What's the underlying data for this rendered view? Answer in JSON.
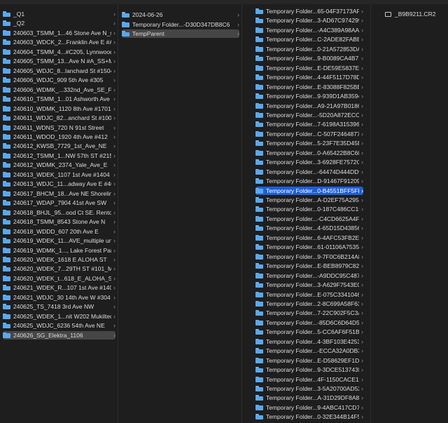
{
  "column1": {
    "items": [
      {
        "label": "_Q1"
      },
      {
        "label": "_Q2"
      },
      {
        "label": "240603_TSMM_1...46 Stone Ave N_ss"
      },
      {
        "label": "240603_WDCK_2...Franklin Ave E #A"
      },
      {
        "label": "240604_TSMM_4...#C205, Lynnwood"
      },
      {
        "label": "240605_TSMM_13...Ave N #A_SS+MP"
      },
      {
        "label": "240605_WDJC_8...lanchard St #1504"
      },
      {
        "label": "240606_WDJC_909 5th Ave #305"
      },
      {
        "label": "240606_WDMK_...332nd_Ave_SE_FC"
      },
      {
        "label": "240610_TSMM_1...01 Ashworth Ave N"
      },
      {
        "label": "240610_WDMK_1120 8th Ave #1701"
      },
      {
        "label": "240611_WDJC_82...anchard St #1003"
      },
      {
        "label": "240611_WDNS_720 N 91st Street"
      },
      {
        "label": "240611_WDOD_1920 4th Ave #412"
      },
      {
        "label": "240612_KWSB_7729_1st_Ave_NE"
      },
      {
        "label": "240612_TSMM_1...NW 57th ST #215"
      },
      {
        "label": "240612_WDMK_2374_Yale_Ave_E"
      },
      {
        "label": "240613_WDEK_1107 1st Ave #1404"
      },
      {
        "label": "240613_WDJC_11...adway Ave E #401"
      },
      {
        "label": "240617_BHCM_18...Ave NE Shoreline"
      },
      {
        "label": "240617_WDAP_7904 41st Ave SW"
      },
      {
        "label": "240618_BHJL_95...ood Ct SE. Renton"
      },
      {
        "label": "240618_TSMM_8543 Stone Ave N"
      },
      {
        "label": "240618_WDDD_607 20th Ave E"
      },
      {
        "label": "240619_WDEK_11...AVE_multiple units"
      },
      {
        "label": "240619_WDMK_1..., Lake Forest Park"
      },
      {
        "label": "240620_WDEK_1618 E ALOHA ST"
      },
      {
        "label": "240620_WDEK_7...29TH ST #101_MI"
      },
      {
        "label": "240620_WDEK_t...618_E_ALOHA_ST"
      },
      {
        "label": "240621_WDEK_R...107 1st Ave #1404"
      },
      {
        "label": "240621_WDJC_30 14th Ave W #304"
      },
      {
        "label": "240625_TS_7418 3rd Ave NW"
      },
      {
        "label": "240625_WDEK_1...nit W202 Mukilteo"
      },
      {
        "label": "240625_WDJC_6236 54th Ave NE"
      },
      {
        "label": "240626_SG_Elektra_1106"
      }
    ]
  },
  "column2": {
    "items": [
      {
        "label": "2024-06-26"
      },
      {
        "label": "Temporary Folder...-D30D347DB8C6"
      },
      {
        "label": "TempParent"
      }
    ]
  },
  "column3": {
    "items": [
      {
        "label": "Temporary Folder...65-04F37173AF1D"
      },
      {
        "label": "Temporary Folder...3-AD67C9742992"
      },
      {
        "label": "Temporary Folder...-A4C389A98AA2"
      },
      {
        "label": "Temporary Folder...C-2ADE82FABB7C"
      },
      {
        "label": "Temporary Folder...0-21A572853DAA"
      },
      {
        "label": "Temporary Folder...9-B0089CA4B714"
      },
      {
        "label": "Temporary Folder...E-DE59E5837E76"
      },
      {
        "label": "Temporary Folder...4-44F5117D78DD"
      },
      {
        "label": "Temporary Folder...E-83088F825BBE"
      },
      {
        "label": "Temporary Folder...9-939D1AB3594A"
      },
      {
        "label": "Temporary Folder...A9-21A97B018617"
      },
      {
        "label": "Temporary Folder...-5D20A872ECCC"
      },
      {
        "label": "Temporary Folder...7-6198A315396C"
      },
      {
        "label": "Temporary Folder...C-507F24648778"
      },
      {
        "label": "Temporary Folder...5-23F7E35D45B5"
      },
      {
        "label": "Temporary Folder...0-A65422B8C60C"
      },
      {
        "label": "Temporary Folder...3-6928FE7572C8"
      },
      {
        "label": "Temporary Folder...-64474D444DD9"
      },
      {
        "label": "Temporary Folder...D-91467F91209D"
      },
      {
        "label": "Temporary Folder...0-B4551BFF5FFF"
      },
      {
        "label": "Temporary Folder...A-D2EF75A29530"
      },
      {
        "label": "Temporary Folder...0-187C486CC151"
      },
      {
        "label": "Temporary Folder...-C4CD6625A4F0"
      },
      {
        "label": "Temporary Folder...4-65D15D43856A"
      },
      {
        "label": "Temporary Folder...6-4AFC53FB2E01"
      },
      {
        "label": "Temporary Folder...61-01106A753536"
      },
      {
        "label": "Temporary Folder...9-7F0C6B214A85"
      },
      {
        "label": "Temporary Folder...E-BEB8979C8220"
      },
      {
        "label": "Temporary Folder...-A9DDC95C4872"
      },
      {
        "label": "Temporary Folder...3-A629F7543E02"
      },
      {
        "label": "Temporary Folder...E-075C33410461"
      },
      {
        "label": "Temporary Folder...2-8C699A58F637"
      },
      {
        "label": "Temporary Folder...7-22C902F5C3AF"
      },
      {
        "label": "Temporary Folder...-85D6C6D64D54"
      },
      {
        "label": "Temporary Folder...5-CC6AF6F51BFA"
      },
      {
        "label": "Temporary Folder...4-3BF103E4253A"
      },
      {
        "label": "Temporary Folder...-ECCA32A0DB3E"
      },
      {
        "label": "Temporary Folder...E-D58629EF1D2A"
      },
      {
        "label": "Temporary Folder...9-3DCE513743DD"
      },
      {
        "label": "Temporary Folder...4F-1150CACE1131"
      },
      {
        "label": "Temporary Folder...3-5A20700AD52A"
      },
      {
        "label": "Temporary Folder...A-31D29DF8A878"
      },
      {
        "label": "Temporary Folder...9-4ABC417CD7A1"
      },
      {
        "label": "Temporary Folder...0-32E344B14F55"
      }
    ]
  },
  "column4": {
    "file": {
      "label": "_B9B9211.CR2",
      "icon": "document-icon"
    }
  },
  "icons": {
    "folder": "folder-icon",
    "chevron": "chevron-right-icon"
  },
  "colors": {
    "folder": "#5aa8ef",
    "selection_active": "#1d5ed8",
    "selection_inactive": "#464646",
    "background": "#1e1e1e"
  },
  "selected": {
    "column1": "240626_SG_Elektra_1106",
    "column2": "TempParent",
    "column3": "Temporary Folder...0-B4551BFF5FFF"
  }
}
